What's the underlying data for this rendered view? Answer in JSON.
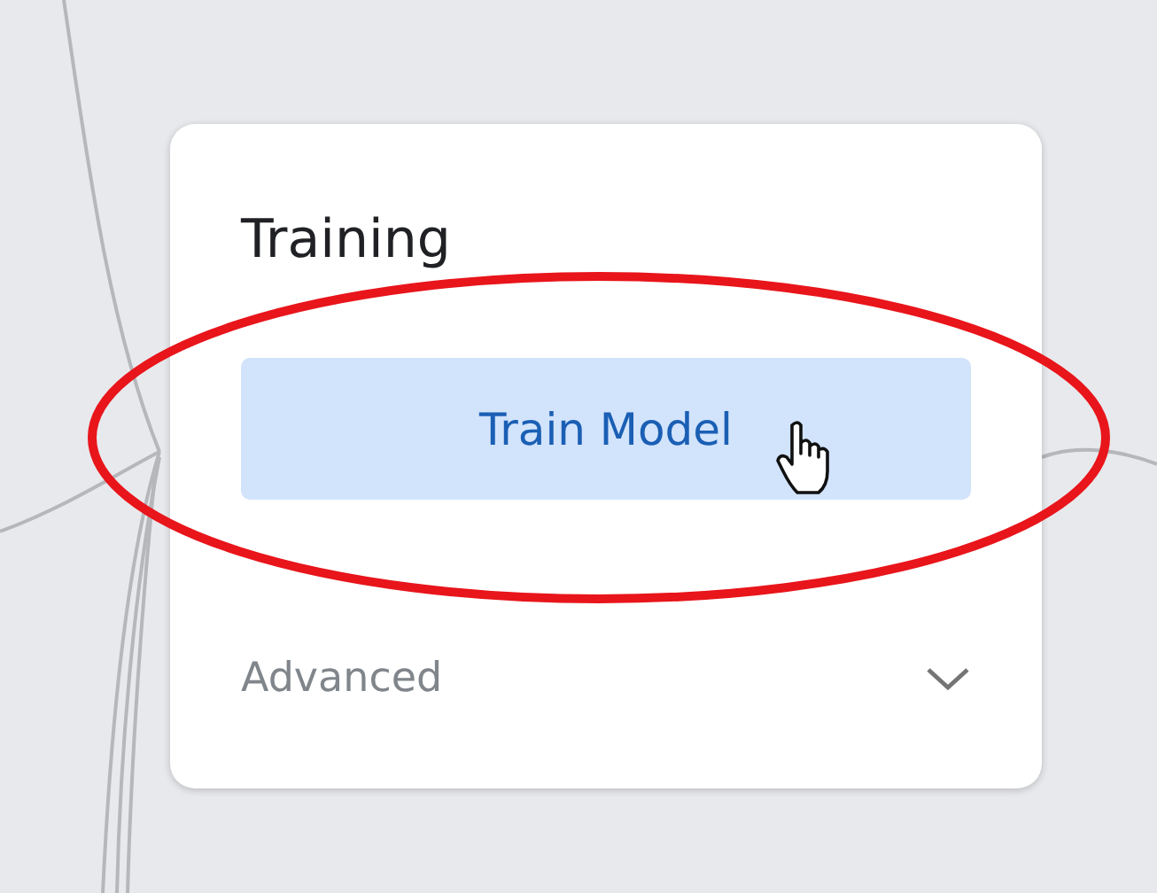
{
  "card": {
    "title": "Training",
    "button": {
      "label": "Train Model"
    },
    "advanced": {
      "label": "Advanced",
      "expanded": false
    }
  }
}
